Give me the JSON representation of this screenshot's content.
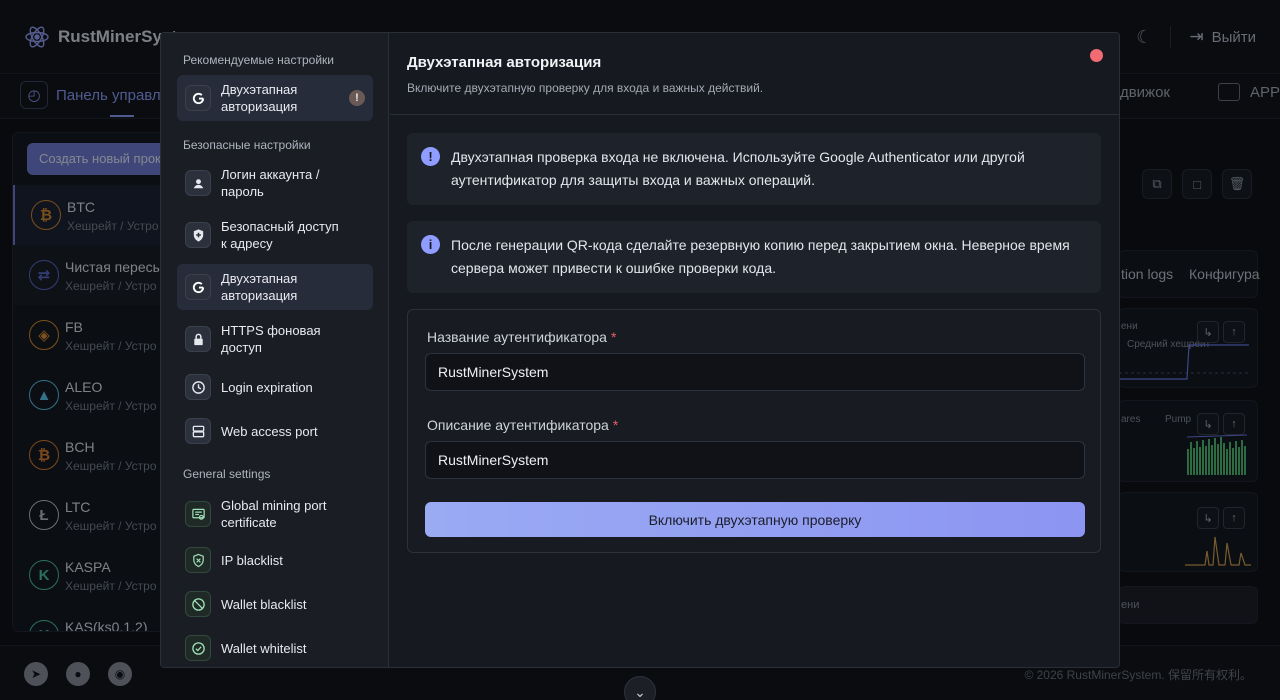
{
  "app": {
    "brand": "RustMinerSystem",
    "logout_label": "Выйти"
  },
  "nav": {
    "dashboard_label": "Панель управле",
    "engine_label": "движок",
    "app_label": "APP"
  },
  "left_panel": {
    "create_button": "Создать новый прокс",
    "coins": [
      {
        "name": "BTC",
        "sub": "Хешрейт / Устро",
        "icon": "bitcoin-icon",
        "glyph": "₿",
        "color": "#d98a2b"
      },
      {
        "name": "Чистая пересы",
        "sub": "Хешрейт / Устро",
        "icon": "transfer-icon",
        "glyph": "⇄",
        "color": "#5a6ad0"
      },
      {
        "name": "FB",
        "sub": "Хешрейт / Устро",
        "icon": "fb-icon",
        "glyph": "◈",
        "color": "#e0902c"
      },
      {
        "name": "ALEO",
        "sub": "Хешрейт / Устро",
        "icon": "aleo-icon",
        "glyph": "▲",
        "color": "#5cc6f0"
      },
      {
        "name": "BCH",
        "sub": "Хешрейт / Устро",
        "icon": "bch-icon",
        "glyph": "₿",
        "color": "#e07e2c"
      },
      {
        "name": "LTC",
        "sub": "Хешрейт / Устро",
        "icon": "litecoin-icon",
        "glyph": "Ł",
        "color": "#bfc3cb"
      },
      {
        "name": "KASPA",
        "sub": "Хешрейт / Устро",
        "icon": "kaspa-icon",
        "glyph": "K",
        "color": "#49c6a4"
      },
      {
        "name": "KAS(ks0.1.2)",
        "sub": "",
        "icon": "kaspa-icon",
        "glyph": "K",
        "color": "#49c6a4"
      }
    ]
  },
  "right_bg": {
    "tab1": "tion logs",
    "tab2": "Конфигура",
    "legend1": "ени",
    "legend2": "Средний хешрейт",
    "legend3": "ares",
    "legend4": "Pump",
    "bottom_text": "ени"
  },
  "footer": {
    "copyright": "© 2026 RustMinerSystem. 保留所有权利。"
  },
  "modal": {
    "sidebar": {
      "section_recommended": "Рекомендуемые настройки",
      "section_security": "Безопасные настройки",
      "section_general": "General settings",
      "items": [
        {
          "label": "Двухэтапная авторизация",
          "icon": "google-icon"
        },
        {
          "label": "Логин аккаунта / пароль",
          "icon": "user-icon"
        },
        {
          "label": "Безопасный доступ к адресу",
          "icon": "shield-icon"
        },
        {
          "label": "Двухэтапная авторизация",
          "icon": "google-icon"
        },
        {
          "label": "HTTPS фоновая доступ",
          "icon": "lock-icon"
        },
        {
          "label": "Login expiration",
          "icon": "clock-icon"
        },
        {
          "label": "Web access port",
          "icon": "server-icon"
        },
        {
          "label": "Global mining port certificate",
          "icon": "certificate-icon"
        },
        {
          "label": "IP blacklist",
          "icon": "shield-x-icon"
        },
        {
          "label": "Wallet blacklist",
          "icon": "ban-icon"
        },
        {
          "label": "Wallet whitelist",
          "icon": "check-circle-icon"
        }
      ],
      "warn_badge": "!"
    },
    "title": "Двухэтапная авторизация",
    "subtitle": "Включите двухэтапную проверку для входа и важных действий.",
    "alert1": "Двухэтапная проверка входа не включена. Используйте Google Authenticator или другой аутентификатор для защиты входа и важных операций.",
    "alert2": "После генерации QR-кода сделайте резервную копию перед закрытием окна. Неверное время сервера может привести к ошибке проверки кода.",
    "alert_glyph1": "!",
    "alert_glyph2": "i",
    "form": {
      "name_label": "Название аутентификатора",
      "name_value": "RustMinerSystem",
      "desc_label": "Описание аутентификатора",
      "desc_value": "RustMinerSystem",
      "required_mark": "*",
      "submit_label": "Включить двухэтапную проверку"
    }
  }
}
